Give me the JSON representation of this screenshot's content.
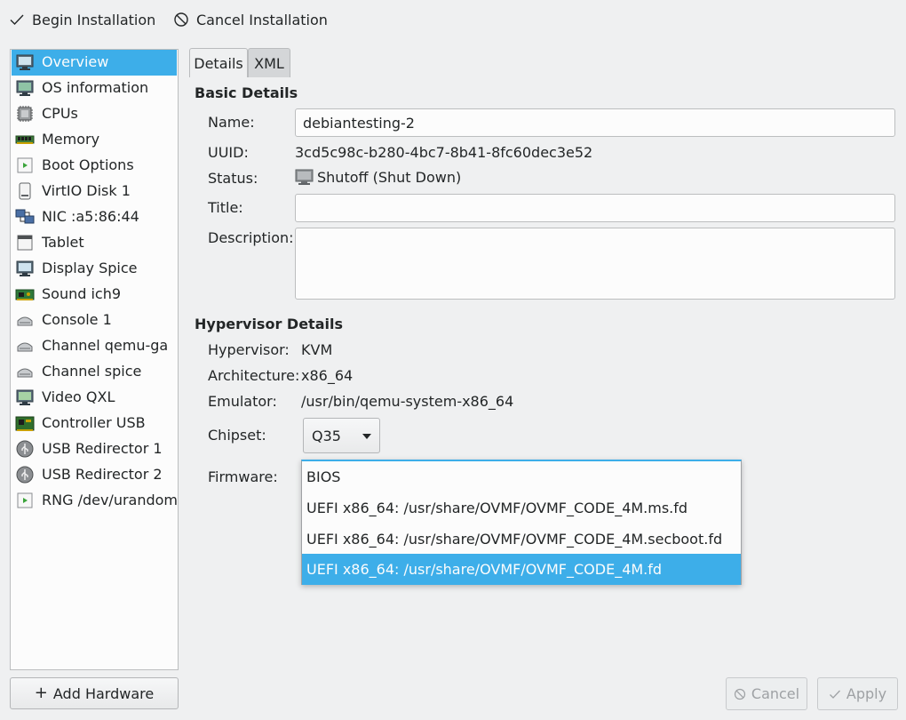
{
  "toolbar": {
    "begin_label": "Begin Installation",
    "cancel_label": "Cancel Installation"
  },
  "sidebar": {
    "items": [
      {
        "label": "Overview",
        "icon": "overview-icon"
      },
      {
        "label": "OS information",
        "icon": "os-info-icon"
      },
      {
        "label": "CPUs",
        "icon": "cpu-icon"
      },
      {
        "label": "Memory",
        "icon": "memory-icon"
      },
      {
        "label": "Boot Options",
        "icon": "boot-options-icon"
      },
      {
        "label": "VirtIO Disk 1",
        "icon": "disk-icon"
      },
      {
        "label": "NIC :a5:86:44",
        "icon": "network-icon"
      },
      {
        "label": "Tablet",
        "icon": "tablet-icon"
      },
      {
        "label": "Display Spice",
        "icon": "display-icon"
      },
      {
        "label": "Sound ich9",
        "icon": "sound-card-icon"
      },
      {
        "label": "Console 1",
        "icon": "serial-port-icon"
      },
      {
        "label": "Channel qemu-ga",
        "icon": "channel-icon"
      },
      {
        "label": "Channel spice",
        "icon": "channel-icon"
      },
      {
        "label": "Video QXL",
        "icon": "video-icon"
      },
      {
        "label": "Controller USB",
        "icon": "controller-icon"
      },
      {
        "label": "USB Redirector 1",
        "icon": "usb-icon"
      },
      {
        "label": "USB Redirector 2",
        "icon": "usb-icon"
      },
      {
        "label": "RNG /dev/urandom",
        "icon": "rng-icon"
      }
    ],
    "add_hardware_label": "Add Hardware"
  },
  "tabs": [
    {
      "label": "Details",
      "active": true
    },
    {
      "label": "XML",
      "active": false
    }
  ],
  "basic": {
    "title": "Basic Details",
    "name_label": "Name:",
    "name_value": "debiantesting-2",
    "uuid_label": "UUID:",
    "uuid_value": "3cd5c98c-b280-4bc7-8b41-8fc60dec3e52",
    "status_label": "Status:",
    "status_value": "Shutoff (Shut Down)",
    "title_label": "Title:",
    "title_value": "",
    "description_label": "Description:",
    "description_value": ""
  },
  "hypervisor": {
    "title": "Hypervisor Details",
    "hypervisor_label": "Hypervisor:",
    "hypervisor_value": "KVM",
    "arch_label": "Architecture:",
    "arch_value": "x86_64",
    "emulator_label": "Emulator:",
    "emulator_value": "/usr/bin/qemu-system-x86_64",
    "chipset_label": "Chipset:",
    "chipset_value": "Q35",
    "firmware_label": "Firmware:"
  },
  "firmware_options": [
    {
      "label": "BIOS",
      "selected": false
    },
    {
      "label": "UEFI x86_64: /usr/share/OVMF/OVMF_CODE_4M.ms.fd",
      "selected": false
    },
    {
      "label": "UEFI x86_64: /usr/share/OVMF/OVMF_CODE_4M.secboot.fd",
      "selected": false
    },
    {
      "label": "UEFI x86_64: /usr/share/OVMF/OVMF_CODE_4M.fd",
      "selected": true
    }
  ],
  "footer": {
    "cancel_label": "Cancel",
    "apply_label": "Apply"
  },
  "colors": {
    "accent": "#3daee9",
    "window_bg": "#eff0f1",
    "text": "#232627"
  }
}
